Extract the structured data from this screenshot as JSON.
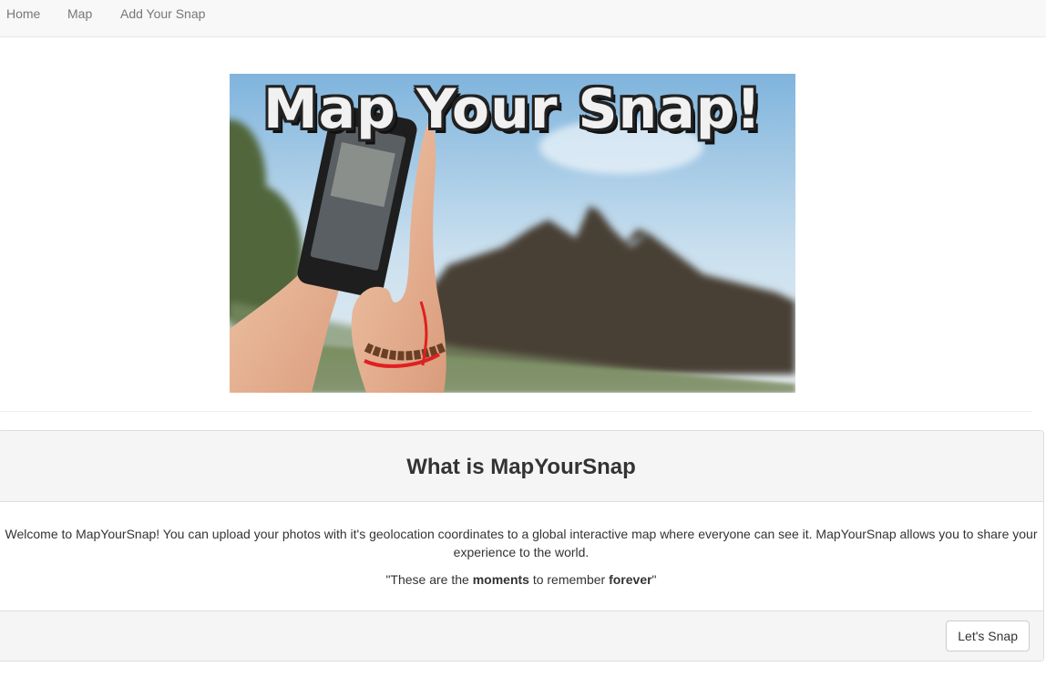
{
  "nav": {
    "items": [
      {
        "label": "Home"
      },
      {
        "label": "Map"
      },
      {
        "label": "Add Your Snap"
      }
    ]
  },
  "hero": {
    "title": "Map Your Snap!"
  },
  "panel": {
    "heading": "What is MapYourSnap",
    "description": "Welcome to MapYourSnap! You can upload your photos with it's geolocation coordinates to a global interactive map where everyone can see it. MapYourSnap allows you to share your experience to the world.",
    "quote": {
      "part1": "\"These are the ",
      "bold1": "moments",
      "part2": " to remember ",
      "bold2": "forever",
      "part3": "\""
    },
    "button_label": "Let's Snap"
  },
  "colors": {
    "nav_bg": "#f8f8f8",
    "nav_text": "#777777",
    "panel_bg": "#f5f5f5",
    "border": "#dddddd"
  }
}
